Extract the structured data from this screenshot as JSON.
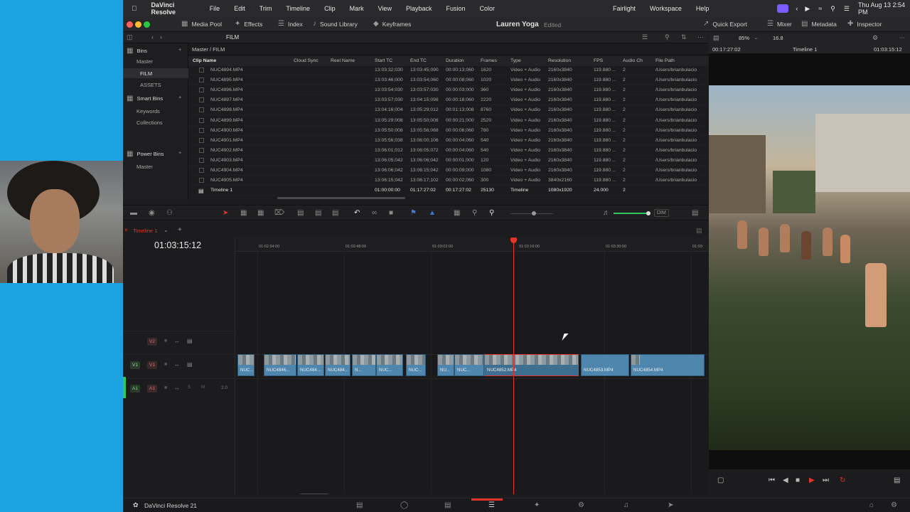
{
  "menubar": {
    "app": "DaVinci Resolve",
    "items": [
      "File",
      "Edit",
      "Trim",
      "Timeline",
      "Clip",
      "Mark",
      "View",
      "Playback",
      "Fusion",
      "Color"
    ],
    "right_items": [
      "Fairlight",
      "Workspace",
      "Help"
    ],
    "datetime": "Thu Aug 13  2:54 PM"
  },
  "toolbar_top": {
    "media_pool": "Media Pool",
    "effects": "Effects",
    "index": "Index",
    "sound_library": "Sound Library",
    "keyframes": "Keyframes",
    "quick_export": "Quick Export",
    "mixer": "Mixer",
    "metadata": "Metadata",
    "inspector": "Inspector"
  },
  "project": {
    "title": "Lauren Yoga",
    "status": "Edited"
  },
  "pool": {
    "bin_name": "FILM",
    "path": "Master / FILM"
  },
  "bins": {
    "bins_label": "Bins",
    "master": "Master",
    "film": "FILM",
    "assets": "ASSETS",
    "smart_bins": "Smart Bins",
    "keywords": "Keywords",
    "collections": "Collections",
    "power_bins": "Power Bins",
    "power_master": "Master"
  },
  "columns": [
    "Clip Name",
    "Cloud Sync",
    "Reel Name",
    "Start TC",
    "End TC",
    "Duration",
    "Frames",
    "Type",
    "Resolution",
    "FPS",
    "Audio Ch",
    "File Path"
  ],
  "clips": [
    {
      "name": "NUC4894.MP4",
      "start": "13:03:32;030",
      "end": "13:03:45;090",
      "dur": "00:00:13;060",
      "frames": "1620",
      "type": "Video + Audio",
      "res": "2160x3840",
      "fps": "119.880 ...",
      "ach": "2",
      "path": "/Users/brianbulacio"
    },
    {
      "name": "NUC4895.MP4",
      "start": "13:03:46;000",
      "end": "13:03:54;060",
      "dur": "00:00:08;060",
      "frames": "1020",
      "type": "Video + Audio",
      "res": "2160x3840",
      "fps": "119.880 ...",
      "ach": "2",
      "path": "/Users/brianbulacio"
    },
    {
      "name": "NUC4896.MP4",
      "start": "13:03:54;030",
      "end": "13:03:57;030",
      "dur": "00:00:03;000",
      "frames": "360",
      "type": "Video + Audio",
      "res": "2160x3840",
      "fps": "119.880 ...",
      "ach": "2",
      "path": "/Users/brianbulacio"
    },
    {
      "name": "NUC4897.MP4",
      "start": "13:03:57;030",
      "end": "13:04:15;098",
      "dur": "00:00:18;060",
      "frames": "2220",
      "type": "Video + Audio",
      "res": "2160x3840",
      "fps": "119.880 ...",
      "ach": "2",
      "path": "/Users/brianbulacio"
    },
    {
      "name": "NUC4898.MP4",
      "start": "13:04:16;004",
      "end": "13:05:29;012",
      "dur": "00:01:13;008",
      "frames": "8760",
      "type": "Video + Audio",
      "res": "2160x3840",
      "fps": "119.880 ...",
      "ach": "2",
      "path": "/Users/brianbulacio"
    },
    {
      "name": "NUC4899.MP4",
      "start": "13:05:29;008",
      "end": "13:05:50;008",
      "dur": "00:00:21;000",
      "frames": "2520",
      "type": "Video + Audio",
      "res": "2160x3840",
      "fps": "119.880 ...",
      "ach": "2",
      "path": "/Users/brianbulacio"
    },
    {
      "name": "NUC4900.MP4",
      "start": "13:05:50;008",
      "end": "13:05:56;068",
      "dur": "00:00:06;060",
      "frames": "780",
      "type": "Video + Audio",
      "res": "2160x3840",
      "fps": "119.880 ...",
      "ach": "2",
      "path": "/Users/brianbulacio"
    },
    {
      "name": "NUC4901.MP4",
      "start": "13:05:56;038",
      "end": "13:06:00;106",
      "dur": "00:00:04;060",
      "frames": "540",
      "type": "Video + Audio",
      "res": "2160x3840",
      "fps": "119.880 ...",
      "ach": "2",
      "path": "/Users/brianbulacio"
    },
    {
      "name": "NUC4902.MP4",
      "start": "13:06:01;012",
      "end": "13:06:05;072",
      "dur": "00:00:04;060",
      "frames": "540",
      "type": "Video + Audio",
      "res": "2160x3840",
      "fps": "119.880 ...",
      "ach": "2",
      "path": "/Users/brianbulacio"
    },
    {
      "name": "NUC4903.MP4",
      "start": "13:06:05;042",
      "end": "13:06:06;042",
      "dur": "00:00:01;000",
      "frames": "120",
      "type": "Video + Audio",
      "res": "2160x3840",
      "fps": "119.880 ...",
      "ach": "2",
      "path": "/Users/brianbulacio"
    },
    {
      "name": "NUC4904.MP4",
      "start": "13:06:06;042",
      "end": "13:06:15;042",
      "dur": "00:00:09;000",
      "frames": "1080",
      "type": "Video + Audio",
      "res": "2160x3840",
      "fps": "119.880 ...",
      "ach": "2",
      "path": "/Users/brianbulacio"
    },
    {
      "name": "NUC4905.MP4",
      "start": "13:06:15;042",
      "end": "13:06:17;102",
      "dur": "00:00:02;060",
      "frames": "300",
      "type": "Video + Audio",
      "res": "3840x2160",
      "fps": "119.880 ...",
      "ach": "2",
      "path": "/Users/brianbulacio"
    }
  ],
  "timeline_row": {
    "name": "Timeline 1",
    "start": "01:00:00:00",
    "end": "01:17:27:02",
    "dur": "00:17:27:02",
    "frames": "25130",
    "type": "Timeline",
    "res": "1080x1920",
    "fps": "24.000",
    "ach": "2"
  },
  "timeline": {
    "tab": "Timeline 1",
    "timecode": "01:03:15:12",
    "ruler": [
      "01:02:34:00",
      "01:02:48:00",
      "01:03:02:00",
      "01:03:16:00",
      "01:03:30:00",
      "01:03:"
    ],
    "v2": "V2",
    "v1": "V1",
    "a1": "A1",
    "a1_level": "2.0",
    "dim": "DIM",
    "solo": "S",
    "mute": "M"
  },
  "timeline_clips": [
    {
      "label": "NUC..."
    },
    {
      "label": "NUC4846..."
    },
    {
      "label": "NUC484..."
    },
    {
      "label": "NUC484..."
    },
    {
      "label": "N..."
    },
    {
      "label": "NUC..."
    },
    {
      "label": "NUC..."
    },
    {
      "label": "NU..."
    },
    {
      "label": "NUC..."
    },
    {
      "label": "NUC4852.MP4"
    },
    {
      "label": "NUC4853.MP4"
    },
    {
      "label": "NUC4854.MP4"
    }
  ],
  "viewer": {
    "zoom": "85%",
    "fps_value": "16.8",
    "src_tc": "00:17:27:02",
    "timeline_name": "Timeline 1",
    "tc": "01:03:15:12"
  },
  "bottom": {
    "app_version": "DaVinci Resolve 21"
  }
}
